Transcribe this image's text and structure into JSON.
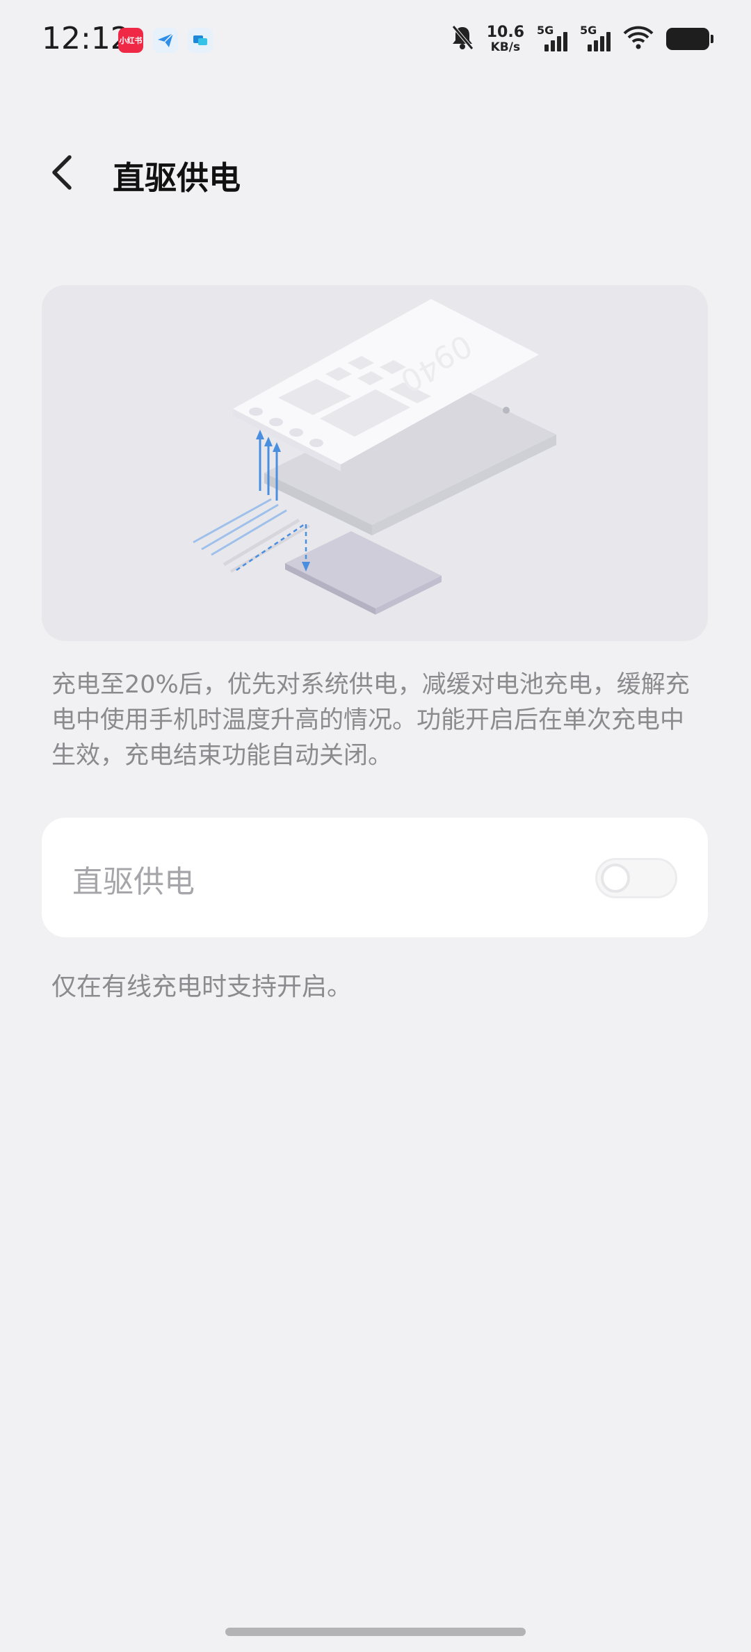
{
  "status_bar": {
    "time": "12:12",
    "apps": [
      {
        "icon": "xiaohongshu-app-icon",
        "text": "小红书"
      },
      {
        "icon": "paper-plane-app-icon",
        "text": ""
      },
      {
        "icon": "chat-app-icon",
        "text": ""
      }
    ],
    "mute_icon": "bell-off-icon",
    "net_speed_value": "10.6",
    "net_speed_unit": "KB/s",
    "sim1_label": "5G",
    "sim2_label": "5G",
    "wifi_icon": "wifi-icon",
    "battery_icon": "battery-icon"
  },
  "header": {
    "back_icon": "chevron-left-icon",
    "title": "直驱供电"
  },
  "illustration": {
    "phone_clock": [
      "09",
      "40"
    ]
  },
  "description": "充电至20%后，优先对系统供电，减缓对电池充电，缓解充电中使用手机时温度升高的情况。功能开启后在单次充电中生效，充电结束功能自动关闭。",
  "setting": {
    "label": "直驱供电",
    "enabled": false
  },
  "hint": "仅在有线充电时支持开启。",
  "colors": {
    "background": "#f1f1f3",
    "card": "#ffffff",
    "secondary_text": "#8a8a8f",
    "arrow_blue": "#4a8ee0"
  }
}
